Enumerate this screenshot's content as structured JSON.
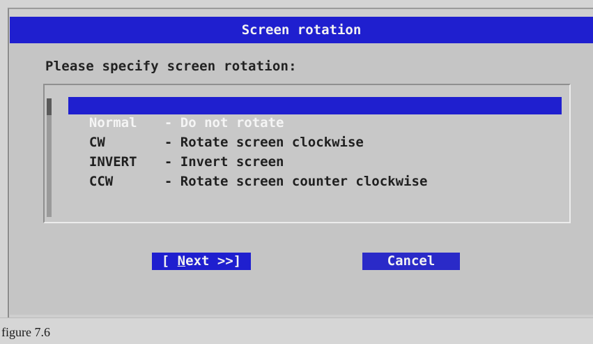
{
  "dialog": {
    "title": "Screen rotation",
    "prompt": "Please specify screen rotation:",
    "options": [
      {
        "key": "Normal",
        "description": "- Do not rotate",
        "selected": true
      },
      {
        "key": "CW",
        "description": "- Rotate screen clockwise",
        "selected": false
      },
      {
        "key": "INVERT",
        "description": "- Invert screen",
        "selected": false
      },
      {
        "key": "CCW",
        "description": "- Rotate screen counter clockwise",
        "selected": false
      }
    ],
    "buttons": {
      "next_open": "[ ",
      "next_hotkey": "N",
      "next_rest": "ext >>]",
      "cancel": "Cancel"
    }
  },
  "caption": "figure 7.6",
  "colors": {
    "selection": "#1f1fcf",
    "dialog_bg": "#c5c5c5",
    "text": "#1f1f1f"
  }
}
